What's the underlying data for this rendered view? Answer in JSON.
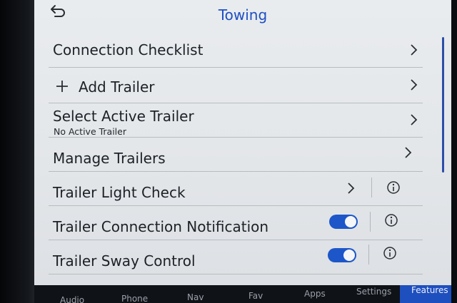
{
  "header": {
    "title": "Towing",
    "back_icon": "back-arrow-icon"
  },
  "rows": [
    {
      "label": "Connection Checklist",
      "control": "chevron"
    },
    {
      "label": "Add Trailer",
      "icon": "plus-icon",
      "control": "chevron"
    },
    {
      "label": "Select Active Trailer",
      "sublabel": "No Active Trailer",
      "control": "chevron"
    },
    {
      "label": "Manage Trailers",
      "control": "chevron"
    },
    {
      "label": "Trailer Light Check",
      "control": "chevron",
      "info": true
    },
    {
      "label": "Trailer Connection Notification",
      "control": "toggle",
      "state": "on",
      "info": true
    },
    {
      "label": "Trailer Sway Control",
      "control": "toggle",
      "state": "on",
      "info": true
    }
  ],
  "bottom_nav": {
    "items": [
      "Audio",
      "Phone",
      "Nav",
      "Fav",
      "Apps",
      "Settings",
      "Features"
    ],
    "active": "Features"
  },
  "colors": {
    "accent": "#1f4fc4",
    "toggle_on": "#1c56c9",
    "background": "#e6e9ec"
  }
}
